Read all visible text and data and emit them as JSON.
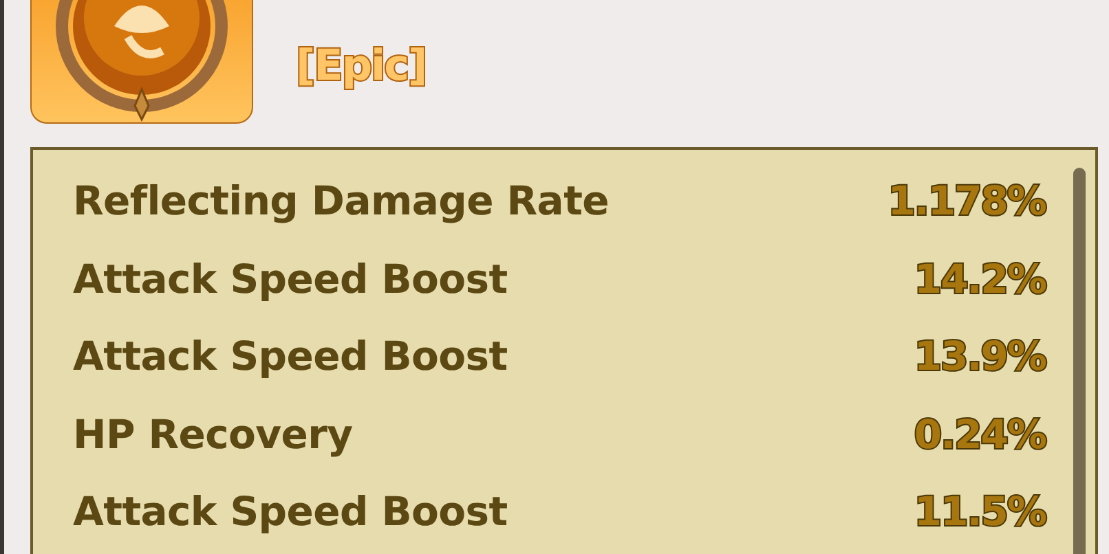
{
  "item": {
    "rarity": "[Epic]"
  },
  "stats": [
    {
      "name": "Reflecting Damage Rate",
      "value": "1.178%"
    },
    {
      "name": "Attack Speed Boost",
      "value": "14.2%"
    },
    {
      "name": "Attack Speed Boost",
      "value": "13.9%"
    },
    {
      "name": "HP Recovery",
      "value": "0.24%"
    },
    {
      "name": "Attack Speed Boost",
      "value": "11.5%"
    }
  ]
}
